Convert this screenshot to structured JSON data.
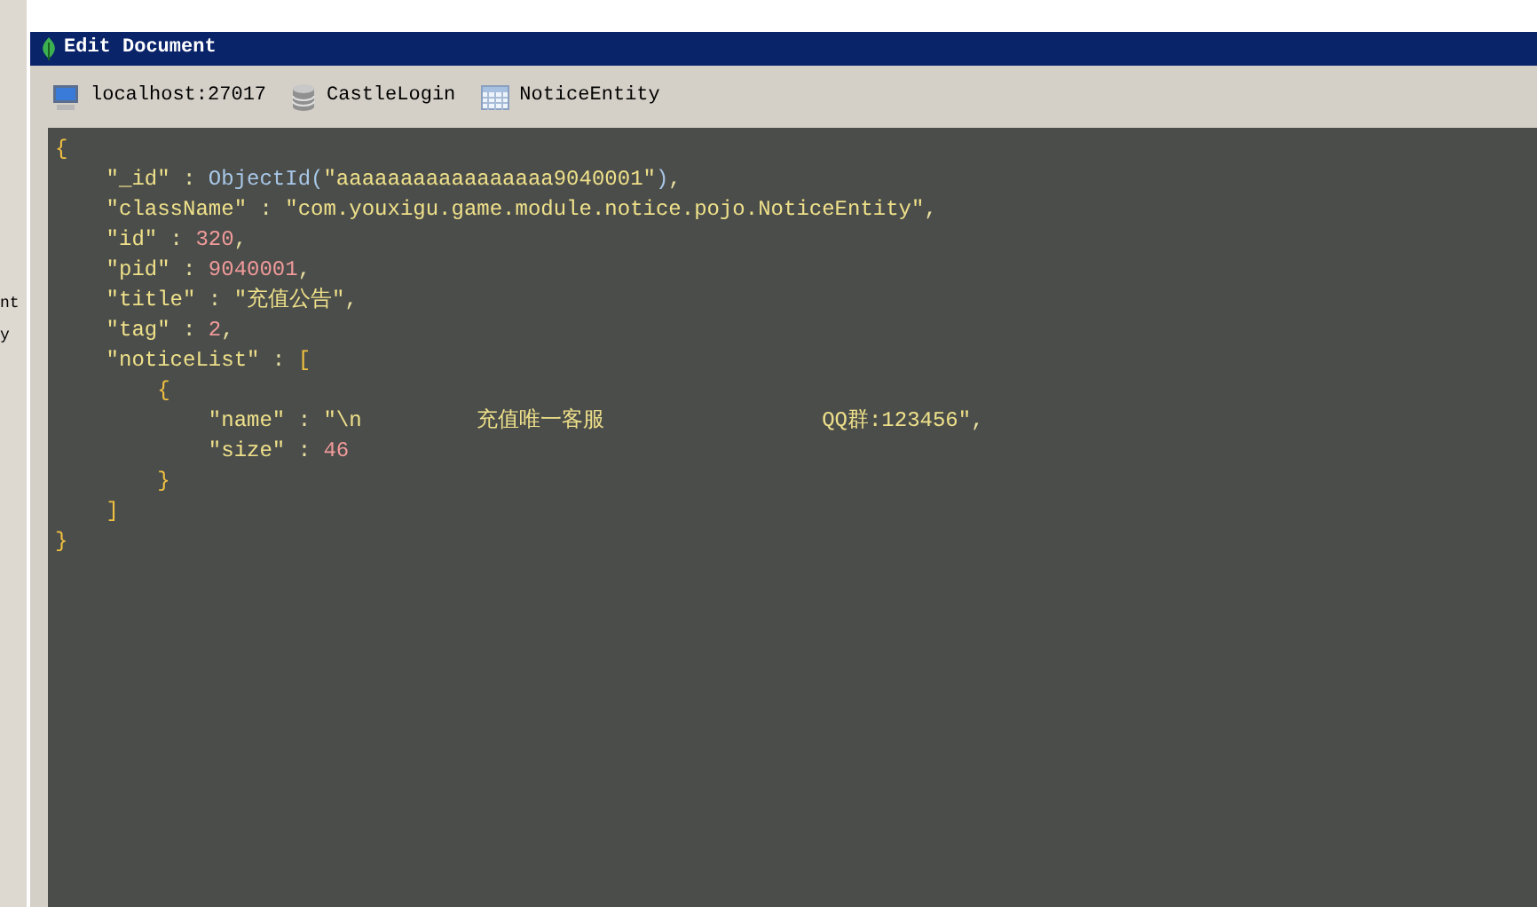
{
  "background_window": {
    "texts": [
      "nt",
      "y"
    ]
  },
  "window": {
    "title": "Edit Document"
  },
  "breadcrumb": [
    {
      "kind": "server",
      "label": "localhost:27017"
    },
    {
      "kind": "database",
      "label": "CastleLogin"
    },
    {
      "kind": "collection",
      "label": "NoticeEntity"
    }
  ],
  "editor": {
    "lines": [
      [
        {
          "kind": "brace",
          "text": "{"
        }
      ],
      [
        {
          "kind": "key",
          "text": "    \"_id\""
        },
        {
          "kind": "plain",
          "text": " : "
        },
        {
          "kind": "func",
          "text": "ObjectId("
        },
        {
          "kind": "string",
          "text": "\"aaaaaaaaaaaaaaaaa9040001\""
        },
        {
          "kind": "func",
          "text": ")"
        },
        {
          "kind": "plain",
          "text": ","
        }
      ],
      [
        {
          "kind": "key",
          "text": "    \"className\""
        },
        {
          "kind": "plain",
          "text": " : "
        },
        {
          "kind": "string",
          "text": "\"com.youxigu.game.module.notice.pojo.NoticeEntity\""
        },
        {
          "kind": "plain",
          "text": ","
        }
      ],
      [
        {
          "kind": "key",
          "text": "    \"id\""
        },
        {
          "kind": "plain",
          "text": " : "
        },
        {
          "kind": "number",
          "text": "320"
        },
        {
          "kind": "plain",
          "text": ","
        }
      ],
      [
        {
          "kind": "key",
          "text": "    \"pid\""
        },
        {
          "kind": "plain",
          "text": " : "
        },
        {
          "kind": "number",
          "text": "9040001"
        },
        {
          "kind": "plain",
          "text": ","
        }
      ],
      [
        {
          "kind": "key",
          "text": "    \"title\""
        },
        {
          "kind": "plain",
          "text": " : "
        },
        {
          "kind": "string",
          "text": "\"充值公告\""
        },
        {
          "kind": "plain",
          "text": ","
        }
      ],
      [
        {
          "kind": "key",
          "text": "    \"tag\""
        },
        {
          "kind": "plain",
          "text": " : "
        },
        {
          "kind": "number",
          "text": "2"
        },
        {
          "kind": "plain",
          "text": ","
        }
      ],
      [
        {
          "kind": "key",
          "text": "    \"noticeList\""
        },
        {
          "kind": "plain",
          "text": " : "
        },
        {
          "kind": "brace",
          "text": "["
        }
      ],
      [
        {
          "kind": "brace",
          "text": "        {"
        }
      ],
      [
        {
          "kind": "key",
          "text": "            \"name\""
        },
        {
          "kind": "plain",
          "text": " : "
        },
        {
          "kind": "string",
          "text": "\"\\n         充值唯一客服                 QQ群:123456\""
        },
        {
          "kind": "plain",
          "text": ","
        }
      ],
      [
        {
          "kind": "key",
          "text": "            \"size\""
        },
        {
          "kind": "plain",
          "text": " : "
        },
        {
          "kind": "number",
          "text": "46"
        }
      ],
      [
        {
          "kind": "brace",
          "text": "        }"
        }
      ],
      [
        {
          "kind": "brace",
          "text": "    ]"
        }
      ],
      [
        {
          "kind": "brace",
          "text": "}"
        }
      ]
    ]
  }
}
